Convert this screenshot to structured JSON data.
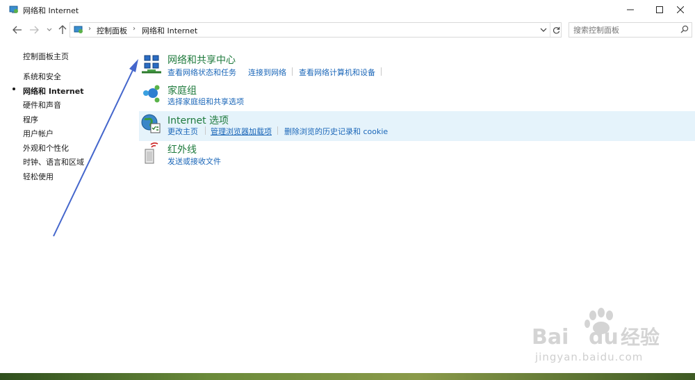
{
  "window": {
    "title": "网络和 Internet",
    "controls": {
      "minimize": "minimize-icon",
      "maximize": "maximize-icon",
      "close": "close-icon"
    }
  },
  "nav": {
    "back": "back-arrow-icon",
    "forward": "forward-arrow-icon",
    "recent": "chevron-down-icon",
    "up": "up-arrow-icon"
  },
  "address": {
    "crumbs": [
      "控制面板",
      "网络和 Internet"
    ],
    "separator": "›"
  },
  "search": {
    "placeholder": "搜索控制面板"
  },
  "sidebar": {
    "home": "控制面板主页",
    "items": [
      {
        "label": "系统和安全",
        "active": false
      },
      {
        "label": "网络和 Internet",
        "active": true
      },
      {
        "label": "硬件和声音",
        "active": false
      },
      {
        "label": "程序",
        "active": false
      },
      {
        "label": "用户帐户",
        "active": false
      },
      {
        "label": "外观和个性化",
        "active": false
      },
      {
        "label": "时钟、语言和区域",
        "active": false
      },
      {
        "label": "轻松使用",
        "active": false
      }
    ]
  },
  "categories": [
    {
      "title": "网络和共享中心",
      "icon": "network-sharing-icon",
      "links": [
        "查看网络状态和任务",
        "连接到网络",
        "查看网络计算机和设备"
      ]
    },
    {
      "title": "家庭组",
      "icon": "homegroup-icon",
      "links": [
        "选择家庭组和共享选项"
      ]
    },
    {
      "title": "Internet 选项",
      "icon": "internet-options-icon",
      "links": [
        "更改主页",
        "管理浏览器加载项",
        "删除浏览的历史记录和 cookie"
      ]
    },
    {
      "title": "红外线",
      "icon": "infrared-icon",
      "links": [
        "发送或接收文件"
      ]
    }
  ],
  "colors": {
    "category_title": "#1e7a3c",
    "link": "#1a66b8",
    "hover_row": "#e5f3fb",
    "arrow": "#4466cc"
  },
  "watermark": {
    "text": "jingyan.baidu.com",
    "logo": "Bai du 经验"
  }
}
